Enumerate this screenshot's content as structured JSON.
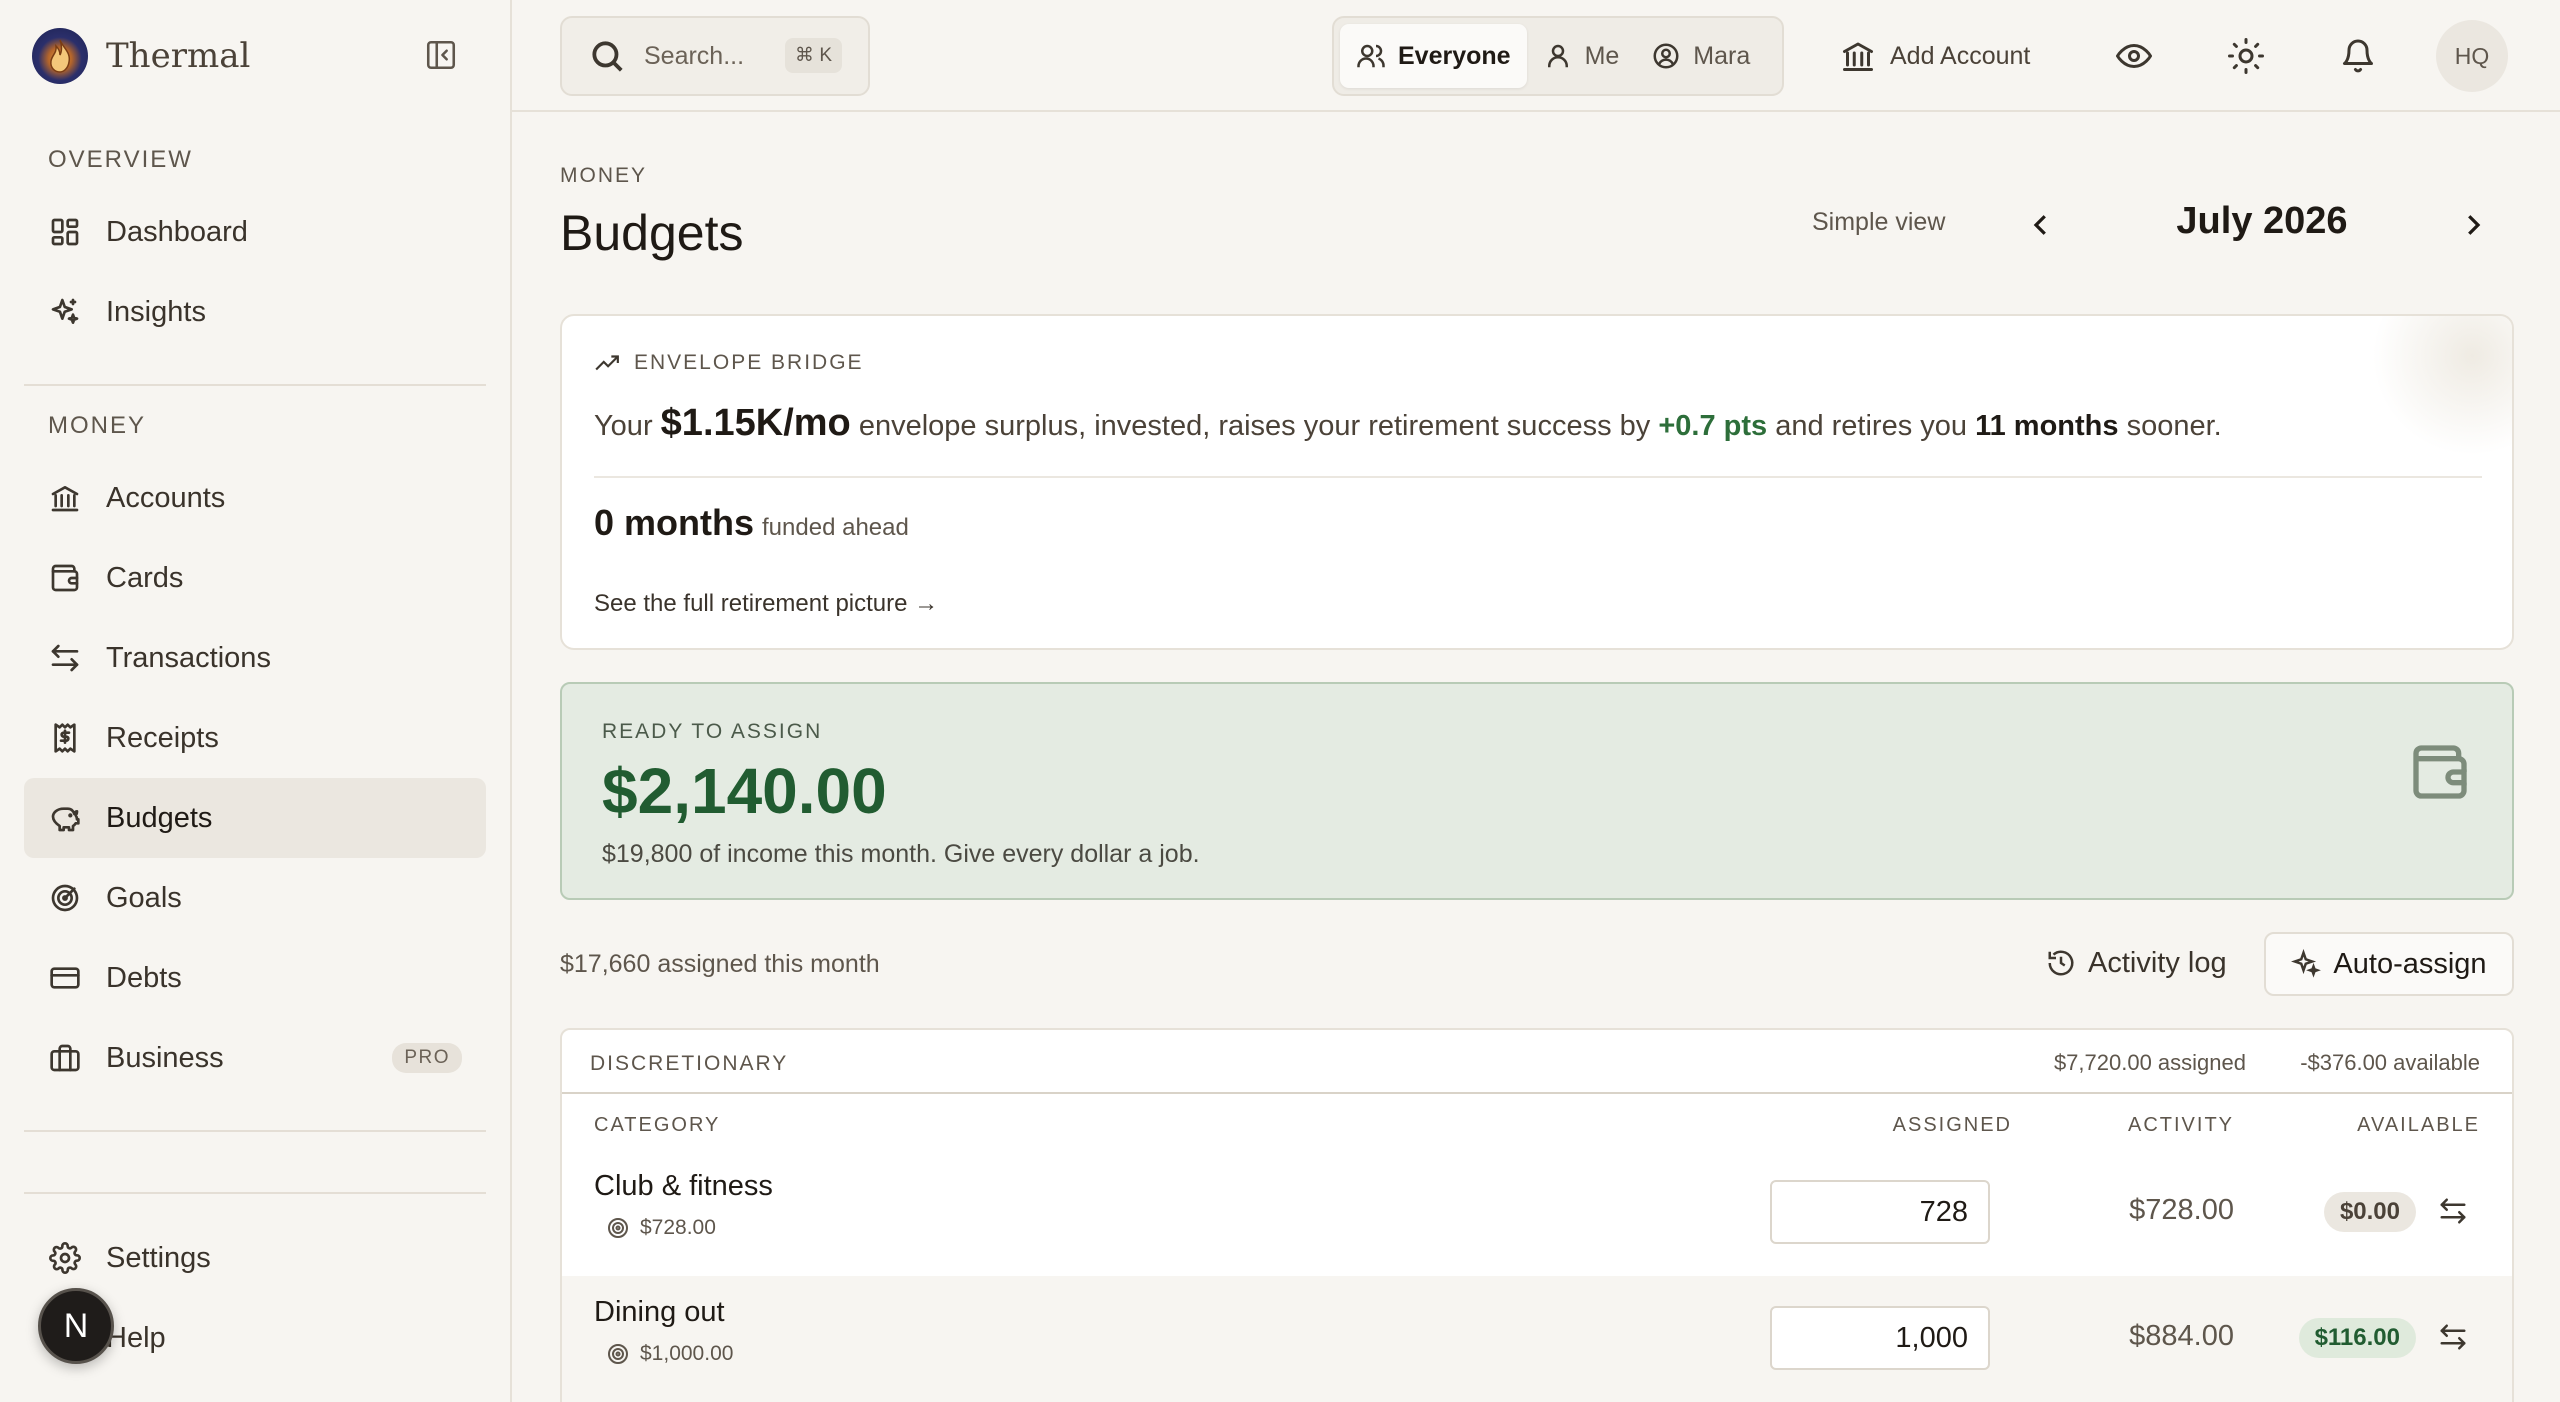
{
  "app": {
    "name": "Thermal"
  },
  "sidebar": {
    "sections": [
      {
        "title": "OVERVIEW"
      },
      {
        "title": "MONEY"
      }
    ],
    "items": [
      {
        "label": "Dashboard",
        "icon": "dashboard-icon"
      },
      {
        "label": "Insights",
        "icon": "sparkles-icon"
      },
      {
        "label": "Accounts",
        "icon": "bank-icon"
      },
      {
        "label": "Cards",
        "icon": "wallet-icon"
      },
      {
        "label": "Transactions",
        "icon": "transfer-icon"
      },
      {
        "label": "Receipts",
        "icon": "receipt-icon"
      },
      {
        "label": "Budgets",
        "icon": "piggy-bank-icon",
        "active": true
      },
      {
        "label": "Goals",
        "icon": "target-icon"
      },
      {
        "label": "Debts",
        "icon": "credit-card-icon"
      },
      {
        "label": "Business",
        "icon": "briefcase-icon",
        "badge": "PRO"
      },
      {
        "label": "Settings",
        "icon": "gear-icon"
      },
      {
        "label": "Help",
        "icon": "help-icon"
      }
    ],
    "user_initial": "N"
  },
  "topbar": {
    "search": {
      "placeholder": "Search...",
      "shortcut": "⌘ K"
    },
    "scope": [
      {
        "label": "Everyone",
        "active": true
      },
      {
        "label": "Me"
      },
      {
        "label": "Mara"
      }
    ],
    "add_account": "Add Account",
    "avatar_initials": "HQ"
  },
  "page": {
    "eyebrow": "MONEY",
    "title": "Budgets",
    "simple_view": "Simple view",
    "month": "July 2026"
  },
  "bridge": {
    "title": "ENVELOPE BRIDGE",
    "text_prefix": "Your",
    "surplus": "$1.15K/mo",
    "text_mid": "envelope surplus, invested, raises your retirement success by",
    "pts": "+0.7 pts",
    "text_mid2": "and retires you",
    "months": "11 months",
    "text_suffix": "sooner.",
    "funded_value": "0 months",
    "funded_label": "funded ahead",
    "link": "See the full retirement picture →"
  },
  "ready": {
    "eyebrow": "READY TO ASSIGN",
    "amount": "$2,140.00",
    "sub": "$19,800 of income this month. Give every dollar a job."
  },
  "assigned_month": "$17,660 assigned this month",
  "actions": {
    "activity_log": "Activity log",
    "auto_assign": "Auto-assign"
  },
  "group": {
    "name": "DISCRETIONARY",
    "assigned": "$7,720.00 assigned",
    "available": "-$376.00 available",
    "columns": {
      "category": "CATEGORY",
      "assigned": "ASSIGNED",
      "activity": "ACTIVITY",
      "available": "AVAILABLE"
    },
    "rows": [
      {
        "name": "Club & fitness",
        "target": "$728.00",
        "assigned": "728",
        "activity": "$728.00",
        "available": "$0.00",
        "status": "neutral"
      },
      {
        "name": "Dining out",
        "target": "$1,000.00",
        "assigned": "1,000",
        "activity": "$884.00",
        "available": "$116.00",
        "status": "positive"
      }
    ]
  },
  "colors": {
    "accent_green": "#215c31",
    "ready_bg": "#e4ebe2",
    "active_nav_bg": "#ebe7e0"
  }
}
